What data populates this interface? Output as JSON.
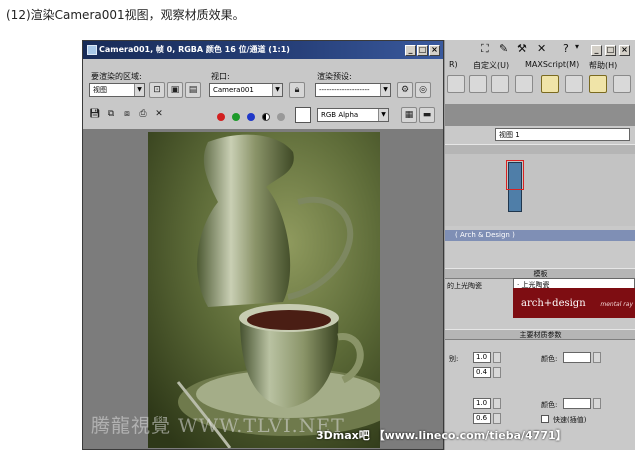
{
  "caption": "(12)渲染Camera001视图，观察材质效果。",
  "render_window": {
    "title": "Camera001, 帧 0, RGBA 颜色 16 位/通道 (1:1)",
    "region_label": "要渲染的区域:",
    "region_value": "视图",
    "viewport_label": "视口:",
    "viewport_value": "Camera001",
    "preset_label": "渲染预设:",
    "preset_value": "--------------------",
    "channel_value": "RGB Alpha",
    "window_buttons": [
      "_",
      "□",
      "×"
    ]
  },
  "max_panel": {
    "menu": [
      "自定义(U)",
      "MAXScript(M)",
      "帮助(H)"
    ],
    "view_select": "视图 1",
    "arch_rollout": "Arch & Design",
    "templates_header": "模板",
    "template_left": "的上光陶瓷",
    "template_select": "上光陶瓷",
    "arch_logo_big": "arch+design",
    "arch_logo_small": "mental ray",
    "main_params_header": "主要材质参数",
    "diffuse": {
      "label": "颜色:",
      "level": "1.0",
      "roughness": "0.4",
      "cut_label": "别:"
    },
    "reflection": {
      "label": "颜色:",
      "reflectivity": "1.0",
      "glossiness": "0.6",
      "fast_label": "快速(插值)"
    },
    "win_buttons": [
      "_",
      "□",
      "×"
    ]
  },
  "watermarks": {
    "left": "腾龍視覺 WWW.TLVI.NET",
    "right": "3Dmax吧 【www.lineco.com/tieba/4771】"
  }
}
